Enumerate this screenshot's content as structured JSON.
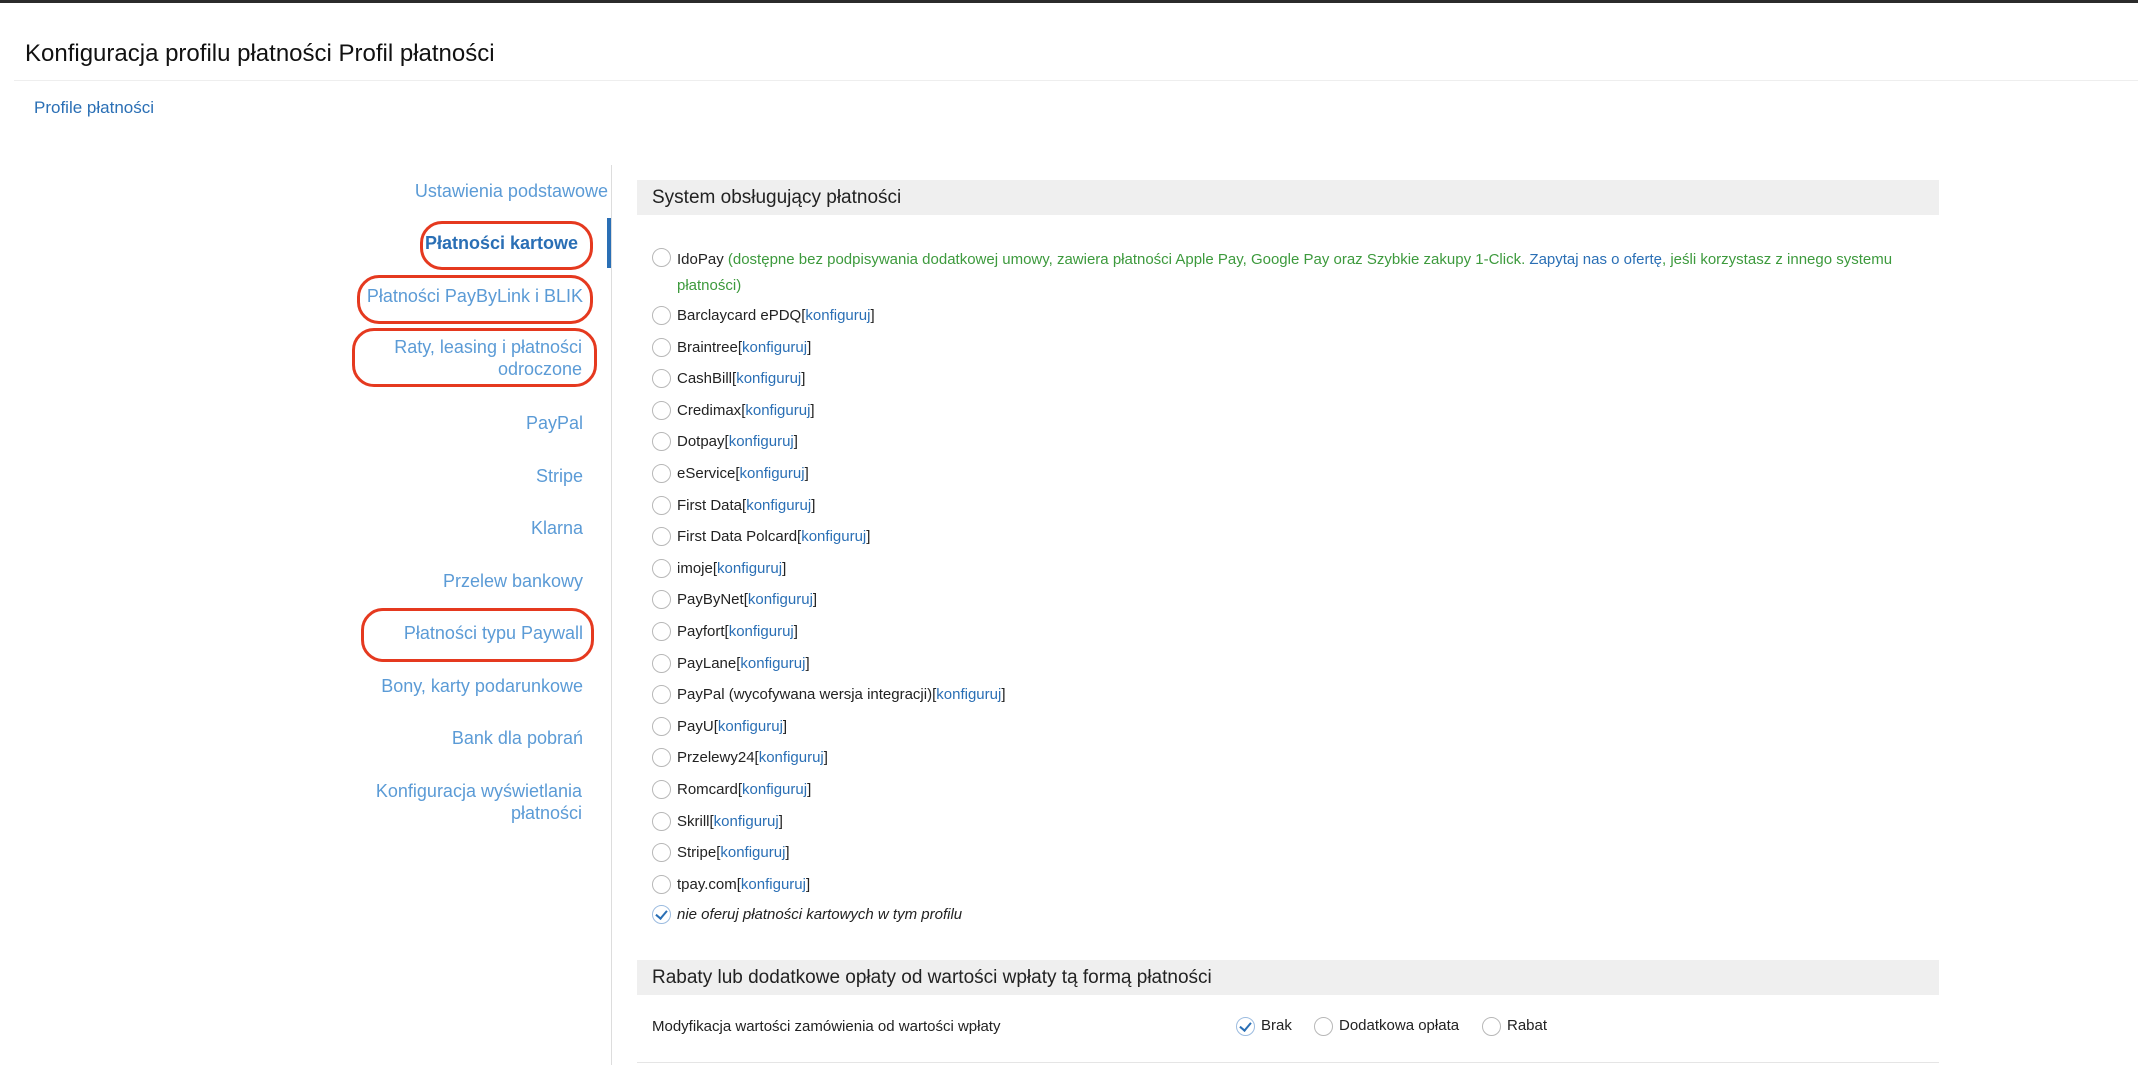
{
  "page": {
    "title": "Konfiguracja profilu płatności Profil płatności",
    "breadcrumb": "Profile płatności"
  },
  "sidebar": {
    "items": [
      {
        "label": "Ustawienia podstawowe"
      },
      {
        "label": "Płatności kartowe"
      },
      {
        "label": "Płatności PayByLink i BLIK"
      },
      {
        "label": "Raty, leasing i płatności odroczone"
      },
      {
        "label": "PayPal"
      },
      {
        "label": "Stripe"
      },
      {
        "label": "Klarna"
      },
      {
        "label": "Przelew bankowy"
      },
      {
        "label": "Płatności typu Paywall"
      },
      {
        "label": "Bony, karty podarunkowe"
      },
      {
        "label": "Bank dla pobrań"
      },
      {
        "label": "Konfiguracja wyświetlania płatności"
      }
    ],
    "highlight_color": "#e5391f",
    "active_color": "#2a6fb5"
  },
  "section1": {
    "title": "System obsługujący płatności",
    "idopay": {
      "name": "IdoPay",
      "desc_open": "(dostępne bez podpisywania dodatkowej umowy, zawiera płatności Apple Pay, Google Pay oraz Szybkie zakupy 1-Click.",
      "link_text": "Zapytaj nas o ofertę",
      "desc_close": ", jeśli korzystasz z innego systemu płatności)"
    },
    "bracket_open": "[",
    "bracket_close": "]",
    "configure_label": "konfiguruj",
    "providers": [
      {
        "name": "Barclaycard ePDQ"
      },
      {
        "name": "Braintree"
      },
      {
        "name": "CashBill"
      },
      {
        "name": "Credimax"
      },
      {
        "name": "Dotpay"
      },
      {
        "name": "eService"
      },
      {
        "name": "First Data"
      },
      {
        "name": "First Data Polcard"
      },
      {
        "name": "imoje"
      },
      {
        "name": "PayByNet"
      },
      {
        "name": "Payfort"
      },
      {
        "name": "PayLane"
      },
      {
        "name": "PayPal (wycofywana wersja integracji)"
      },
      {
        "name": "PayU"
      },
      {
        "name": "Przelewy24"
      },
      {
        "name": "Romcard"
      },
      {
        "name": "Skrill"
      },
      {
        "name": "Stripe"
      },
      {
        "name": "tpay.com"
      }
    ],
    "none_option": "nie oferuj płatności kartowych w tym profilu"
  },
  "section2": {
    "title": "Rabaty lub dodatkowe opłaty od wartości wpłaty tą formą płatności",
    "row_label": "Modyfikacja wartości zamówienia od wartości wpłaty",
    "options": [
      {
        "label": "Brak",
        "checked": true
      },
      {
        "label": "Dodatkowa opłata",
        "checked": false
      },
      {
        "label": "Rabat",
        "checked": false
      }
    ]
  }
}
